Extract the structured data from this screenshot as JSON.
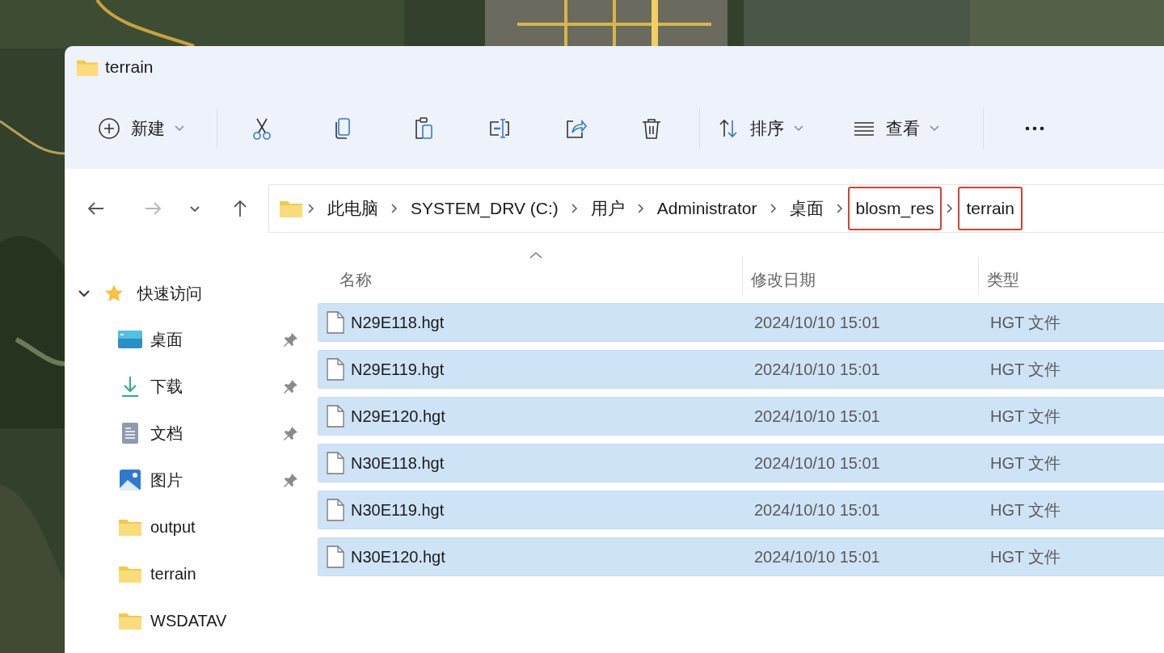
{
  "window": {
    "title": "terrain"
  },
  "toolbar": [
    {
      "kind": "new",
      "label": "新建",
      "dropdown": true
    },
    {
      "kind": "cut"
    },
    {
      "kind": "copy"
    },
    {
      "kind": "paste"
    },
    {
      "kind": "rename"
    },
    {
      "kind": "share"
    },
    {
      "kind": "delete"
    },
    {
      "kind": "sort",
      "label": "排序",
      "dropdown": true
    },
    {
      "kind": "view",
      "label": "查看",
      "dropdown": true
    },
    {
      "kind": "more"
    }
  ],
  "navigation": [
    {
      "kind": "back",
      "disabled": false
    },
    {
      "kind": "forward",
      "disabled": true
    },
    {
      "kind": "recent",
      "disabled": false
    },
    {
      "kind": "up",
      "disabled": false
    }
  ],
  "breadcrumbs": [
    {
      "label": "此电脑",
      "highlighted": false
    },
    {
      "label": "SYSTEM_DRV (C:)",
      "highlighted": false
    },
    {
      "label": "用户",
      "highlighted": false
    },
    {
      "label": "Administrator",
      "highlighted": false
    },
    {
      "label": "桌面",
      "highlighted": false
    },
    {
      "label": "blosm_res",
      "highlighted": true
    },
    {
      "label": "terrain",
      "highlighted": true
    }
  ],
  "sidebar": {
    "group": {
      "label": "快速访问",
      "expanded": true
    },
    "items": [
      {
        "kind": "desktop",
        "label": "桌面",
        "pinned": true
      },
      {
        "kind": "download",
        "label": "下载",
        "pinned": true
      },
      {
        "kind": "documents",
        "label": "文档",
        "pinned": true
      },
      {
        "kind": "pictures",
        "label": "图片",
        "pinned": true
      },
      {
        "kind": "folder",
        "label": "output",
        "pinned": false
      },
      {
        "kind": "folder",
        "label": "terrain",
        "pinned": false
      },
      {
        "kind": "folder",
        "label": "WSDATAV",
        "pinned": false
      }
    ]
  },
  "table": {
    "columns": [
      {
        "label": "名称",
        "sorted": true
      },
      {
        "label": "修改日期",
        "sorted": false
      },
      {
        "label": "类型",
        "sorted": false
      }
    ],
    "rows": [
      {
        "name": "N29E118.hgt",
        "modified": "2024/10/10 15:01",
        "type": "HGT 文件",
        "selected": true
      },
      {
        "name": "N29E119.hgt",
        "modified": "2024/10/10 15:01",
        "type": "HGT 文件",
        "selected": true
      },
      {
        "name": "N29E120.hgt",
        "modified": "2024/10/10 15:01",
        "type": "HGT 文件",
        "selected": true
      },
      {
        "name": "N30E118.hgt",
        "modified": "2024/10/10 15:01",
        "type": "HGT 文件",
        "selected": true
      },
      {
        "name": "N30E119.hgt",
        "modified": "2024/10/10 15:01",
        "type": "HGT 文件",
        "selected": true
      },
      {
        "name": "N30E120.hgt",
        "modified": "2024/10/10 15:01",
        "type": "HGT 文件",
        "selected": true
      }
    ]
  }
}
